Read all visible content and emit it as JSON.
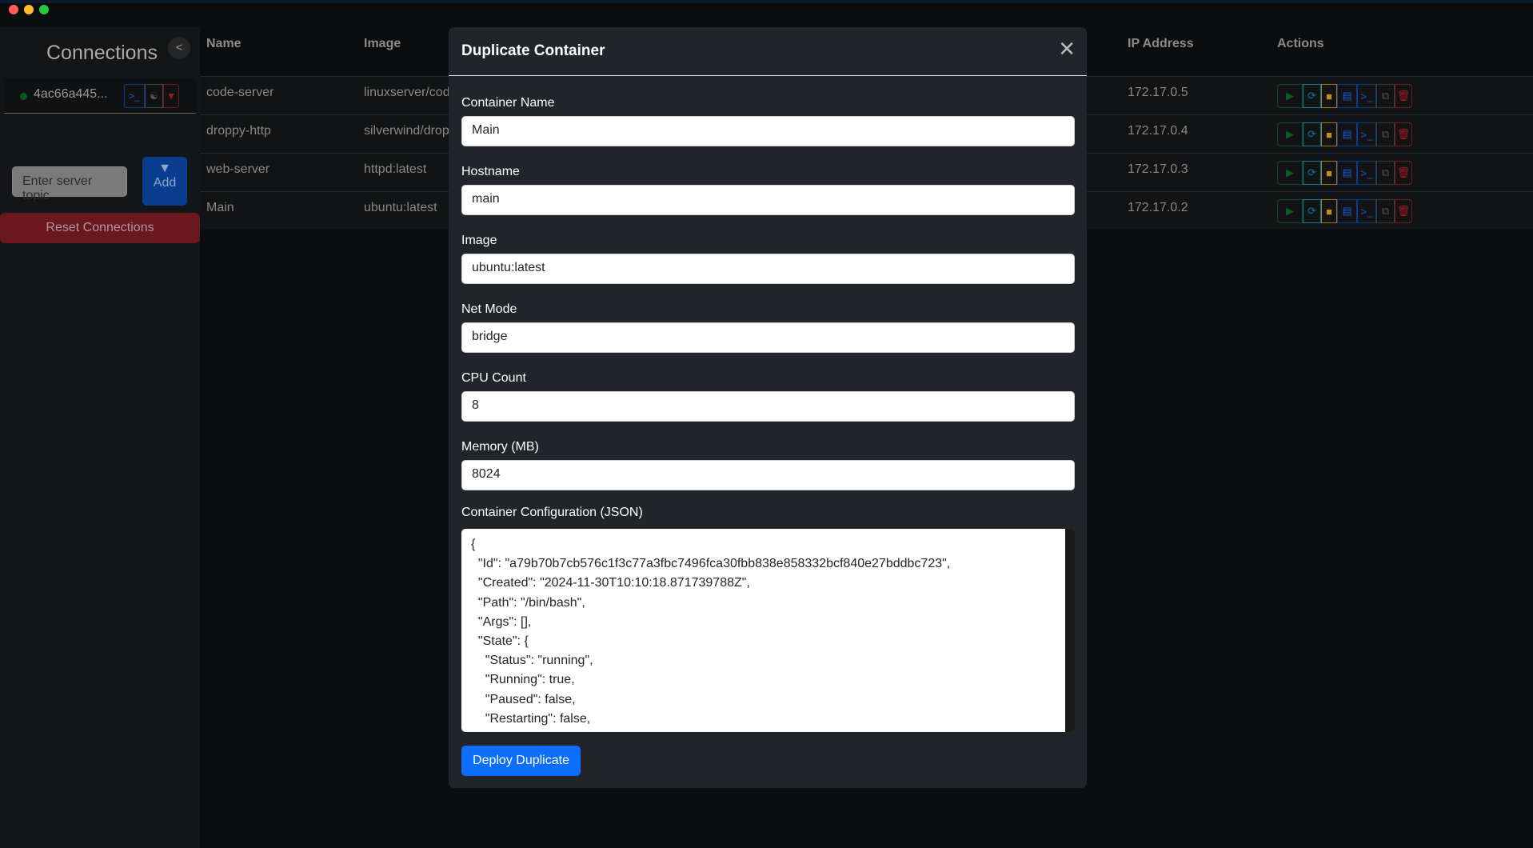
{
  "window": {
    "dots": [
      "#ff5f57",
      "#febc2e",
      "#28c840"
    ]
  },
  "sidebar": {
    "title": "Connections",
    "collapse": "<",
    "connection": {
      "name": "4ac66a445...",
      "status_color": "#0a5a1c",
      "buttons": [
        "terminal-icon",
        "cluster-icon",
        "disconnect-plug-icon"
      ]
    },
    "topic_placeholder": "Enter server topic",
    "add_label": "Add",
    "reset_label": "Reset Connections"
  },
  "table": {
    "headers": {
      "name": "Name",
      "image": "Image",
      "ip": "IP Address",
      "actions": "Actions"
    },
    "rows": [
      {
        "name": "code-server",
        "image": "linuxserver/code-server",
        "ip": "172.17.0.5"
      },
      {
        "name": "droppy-http",
        "image": "silverwind/droppy",
        "ip": "172.17.0.4"
      },
      {
        "name": "web-server",
        "image": "httpd:latest",
        "ip": "172.17.0.3"
      },
      {
        "name": "Main",
        "image": "ubuntu:latest",
        "ip": "172.17.0.2"
      }
    ],
    "actions": [
      "start",
      "restart",
      "stop",
      "logs",
      "terminal",
      "duplicate",
      "delete"
    ]
  },
  "modal": {
    "title": "Duplicate Container",
    "fields": [
      {
        "label": "Container Name",
        "value": "Main"
      },
      {
        "label": "Hostname",
        "value": "main"
      },
      {
        "label": "Image",
        "value": "ubuntu:latest"
      },
      {
        "label": "Net Mode",
        "value": "bridge"
      },
      {
        "label": "CPU Count",
        "value": "8"
      },
      {
        "label": "Memory (MB)",
        "value": "8024"
      }
    ],
    "config_label": "Container Configuration (JSON)",
    "config_value": "{\n  \"Id\": \"a79b70b7cb576c1f3c77a3fbc7496fca30fbb838e858332bcf840e27bddbc723\",\n  \"Created\": \"2024-11-30T10:10:18.871739788Z\",\n  \"Path\": \"/bin/bash\",\n  \"Args\": [],\n  \"State\": {\n    \"Status\": \"running\",\n    \"Running\": true,\n    \"Paused\": false,\n    \"Restarting\": false,",
    "deploy_label": "Deploy Duplicate"
  }
}
